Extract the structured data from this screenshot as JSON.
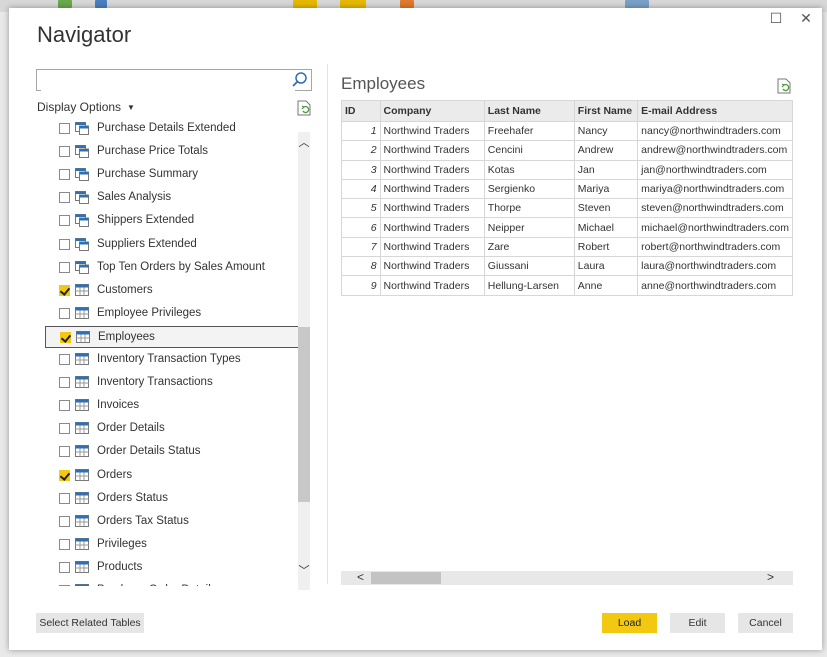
{
  "window": {
    "title": "Navigator",
    "maximize_icon": "maximize-icon",
    "close_icon": "close-icon"
  },
  "search": {
    "placeholder": "",
    "value": ""
  },
  "display_options": {
    "label": "Display Options"
  },
  "navigator_items": [
    {
      "label": "Purchase Details Extended",
      "icon": "view-icon",
      "checked": false
    },
    {
      "label": "Purchase Price Totals",
      "icon": "view-icon",
      "checked": false
    },
    {
      "label": "Purchase Summary",
      "icon": "view-icon",
      "checked": false
    },
    {
      "label": "Sales Analysis",
      "icon": "view-icon",
      "checked": false
    },
    {
      "label": "Shippers Extended",
      "icon": "view-icon",
      "checked": false
    },
    {
      "label": "Suppliers Extended",
      "icon": "view-icon",
      "checked": false
    },
    {
      "label": "Top Ten Orders by Sales Amount",
      "icon": "view-icon",
      "checked": false
    },
    {
      "label": "Customers",
      "icon": "table-icon",
      "checked": true
    },
    {
      "label": "Employee Privileges",
      "icon": "table-icon",
      "checked": false
    },
    {
      "label": "Employees",
      "icon": "table-icon",
      "checked": true,
      "selected": true
    },
    {
      "label": "Inventory Transaction Types",
      "icon": "table-icon",
      "checked": false
    },
    {
      "label": "Inventory Transactions",
      "icon": "table-icon",
      "checked": false
    },
    {
      "label": "Invoices",
      "icon": "table-icon",
      "checked": false
    },
    {
      "label": "Order Details",
      "icon": "table-icon",
      "checked": false
    },
    {
      "label": "Order Details Status",
      "icon": "table-icon",
      "checked": false
    },
    {
      "label": "Orders",
      "icon": "table-icon",
      "checked": true
    },
    {
      "label": "Orders Status",
      "icon": "table-icon",
      "checked": false
    },
    {
      "label": "Orders Tax Status",
      "icon": "table-icon",
      "checked": false
    },
    {
      "label": "Privileges",
      "icon": "table-icon",
      "checked": false
    },
    {
      "label": "Products",
      "icon": "table-icon",
      "checked": false
    },
    {
      "label": "Purchase Order Details",
      "icon": "table-icon",
      "checked": false
    }
  ],
  "preview": {
    "title": "Employees",
    "columns": [
      "ID",
      "Company",
      "Last Name",
      "First Name",
      "E-mail Address"
    ],
    "rows": [
      [
        "1",
        "Northwind Traders",
        "Freehafer",
        "Nancy",
        "nancy@northwindtraders.com"
      ],
      [
        "2",
        "Northwind Traders",
        "Cencini",
        "Andrew",
        "andrew@northwindtraders.com"
      ],
      [
        "3",
        "Northwind Traders",
        "Kotas",
        "Jan",
        "jan@northwindtraders.com"
      ],
      [
        "4",
        "Northwind Traders",
        "Sergienko",
        "Mariya",
        "mariya@northwindtraders.com"
      ],
      [
        "5",
        "Northwind Traders",
        "Thorpe",
        "Steven",
        "steven@northwindtraders.com"
      ],
      [
        "6",
        "Northwind Traders",
        "Neipper",
        "Michael",
        "michael@northwindtraders.com"
      ],
      [
        "7",
        "Northwind Traders",
        "Zare",
        "Robert",
        "robert@northwindtraders.com"
      ],
      [
        "8",
        "Northwind Traders",
        "Giussani",
        "Laura",
        "laura@northwindtraders.com"
      ],
      [
        "9",
        "Northwind Traders",
        "Hellung-Larsen",
        "Anne",
        "anne@northwindtraders.com"
      ]
    ]
  },
  "buttons": {
    "select_related": "Select Related Tables",
    "load": "Load",
    "edit": "Edit",
    "cancel": "Cancel"
  },
  "colors": {
    "accent": "#f2c811",
    "table_icon": "#2f6fb3"
  }
}
